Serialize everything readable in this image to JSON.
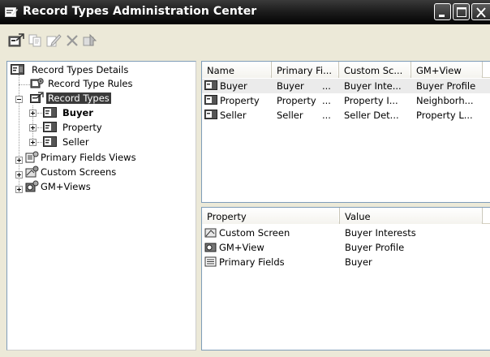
{
  "window": {
    "title": "Record Types Administration Center"
  },
  "toolbar": {
    "buttons": [
      {
        "name": "new-record-type-icon"
      },
      {
        "name": "copy-icon"
      },
      {
        "name": "edit-icon"
      },
      {
        "name": "delete-icon"
      },
      {
        "name": "properties-icon"
      }
    ]
  },
  "tree": {
    "root": "Record Types Details",
    "rules": "Record Type Rules",
    "record_types": "Record Types",
    "buyer": "Buyer",
    "property": "Property",
    "seller": "Seller",
    "primary_fields_views": "Primary Fields Views",
    "custom_screens": "Custom Screens",
    "gm_views": "GM+Views"
  },
  "record_list": {
    "columns": [
      "Name",
      "Primary Fi...",
      "Custom Sc...",
      "GM+View"
    ],
    "rows": [
      {
        "name": "Buyer",
        "primary": "Buyer",
        "dots": "...",
        "custom": "Buyer Inte...",
        "gm": "Buyer Profile"
      },
      {
        "name": "Property",
        "primary": "Property",
        "dots": "...",
        "custom": "Property I...",
        "gm": "Neighborh..."
      },
      {
        "name": "Seller",
        "primary": "Seller",
        "dots": "...",
        "custom": "Seller Det...",
        "gm": "Property L..."
      }
    ]
  },
  "properties": {
    "columns": [
      "Property",
      "Value"
    ],
    "rows": [
      {
        "property": "Custom Screen",
        "value": "Buyer Interests"
      },
      {
        "property": "GM+View",
        "value": "Buyer Profile"
      },
      {
        "property": "Primary Fields",
        "value": "Buyer"
      }
    ]
  }
}
